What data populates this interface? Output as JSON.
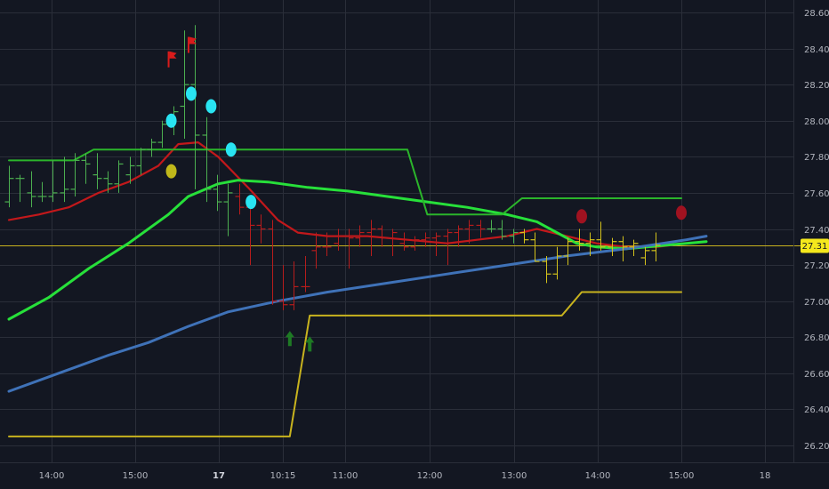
{
  "colors": {
    "background": "#131722",
    "grid": "#2a2e39",
    "bar": "#4caf50",
    "bar_down": "#b71c1c",
    "bar_yellow": "#d4c21b",
    "ma_red": "#c2181b",
    "ma_green": "#27e03a",
    "ma_blue": "#3f72b8",
    "channel_green": "#2bb52b",
    "channel_yellow": "#c8b31e",
    "price_line": "#c8b31e",
    "cyan_marker": "#29e4f2",
    "yellow_marker": "#c0b81a",
    "red_marker": "#a01220",
    "red_flag": "#d81b1b",
    "green_arrow": "#1e7a24",
    "price_tag_bg": "#f5e81c"
  },
  "chart_data": {
    "type": "line",
    "ylim": [
      26.15,
      28.62
    ],
    "y_ticks": [
      "28.60",
      "28.40",
      "28.20",
      "28.00",
      "27.80",
      "27.60",
      "27.40",
      "27.20",
      "27.00",
      "26.80",
      "26.60",
      "26.40",
      "26.20"
    ],
    "x_ticks": [
      {
        "label": "14:00",
        "bold": false
      },
      {
        "label": "15:00",
        "bold": false
      },
      {
        "label": "17",
        "bold": true
      },
      {
        "label": "10:15",
        "bold": false
      },
      {
        "label": "11:00",
        "bold": false
      },
      {
        "label": "12:00",
        "bold": false
      },
      {
        "label": "13:00",
        "bold": false
      },
      {
        "label": "14:00",
        "bold": false
      },
      {
        "label": "15:00",
        "bold": false
      },
      {
        "label": "18",
        "bold": false
      }
    ],
    "current_price": "27.31",
    "current_price_value": 27.31,
    "n_bars": 60,
    "bars": [
      {
        "i": 0,
        "o": 27.55,
        "h": 27.75,
        "l": 27.52,
        "c": 27.68,
        "col": "green"
      },
      {
        "i": 1,
        "o": 27.68,
        "h": 27.7,
        "l": 27.55,
        "c": 27.68,
        "col": "green"
      },
      {
        "i": 2,
        "o": 27.6,
        "h": 27.72,
        "l": 27.52,
        "c": 27.58,
        "col": "green"
      },
      {
        "i": 3,
        "o": 27.58,
        "h": 27.66,
        "l": 27.55,
        "c": 27.58,
        "col": "green"
      },
      {
        "i": 4,
        "o": 27.58,
        "h": 27.78,
        "l": 27.55,
        "c": 27.6,
        "col": "green"
      },
      {
        "i": 5,
        "o": 27.6,
        "h": 27.8,
        "l": 27.55,
        "c": 27.62,
        "col": "green"
      },
      {
        "i": 6,
        "o": 27.62,
        "h": 27.82,
        "l": 27.58,
        "c": 27.78,
        "col": "green"
      },
      {
        "i": 7,
        "o": 27.78,
        "h": 27.82,
        "l": 27.65,
        "c": 27.76,
        "col": "green"
      },
      {
        "i": 8,
        "o": 27.7,
        "h": 27.82,
        "l": 27.62,
        "c": 27.68,
        "col": "green"
      },
      {
        "i": 9,
        "o": 27.68,
        "h": 27.72,
        "l": 27.6,
        "c": 27.65,
        "col": "green"
      },
      {
        "i": 10,
        "o": 27.65,
        "h": 27.78,
        "l": 27.6,
        "c": 27.76,
        "col": "green"
      },
      {
        "i": 11,
        "o": 27.7,
        "h": 27.8,
        "l": 27.65,
        "c": 27.75,
        "col": "green"
      },
      {
        "i": 12,
        "o": 27.75,
        "h": 27.85,
        "l": 27.7,
        "c": 27.84,
        "col": "green"
      },
      {
        "i": 13,
        "o": 27.84,
        "h": 27.9,
        "l": 27.8,
        "c": 27.88,
        "col": "green"
      },
      {
        "i": 14,
        "o": 27.88,
        "h": 28.0,
        "l": 27.85,
        "c": 27.98,
        "col": "green"
      },
      {
        "i": 15,
        "o": 28.0,
        "h": 28.08,
        "l": 27.92,
        "c": 28.05,
        "col": "green"
      },
      {
        "i": 16,
        "o": 28.08,
        "h": 28.5,
        "l": 27.9,
        "c": 28.2,
        "col": "green"
      },
      {
        "i": 17,
        "o": 28.2,
        "h": 28.53,
        "l": 27.62,
        "c": 27.92,
        "col": "green"
      },
      {
        "i": 18,
        "o": 27.92,
        "h": 28.02,
        "l": 27.55,
        "c": 27.62,
        "col": "green"
      },
      {
        "i": 19,
        "o": 27.62,
        "h": 27.7,
        "l": 27.5,
        "c": 27.55,
        "col": "green"
      },
      {
        "i": 20,
        "o": 27.55,
        "h": 27.65,
        "l": 27.36,
        "c": 27.6,
        "col": "green"
      },
      {
        "i": 21,
        "o": 27.58,
        "h": 27.65,
        "l": 27.48,
        "c": 27.52,
        "col": "red"
      },
      {
        "i": 22,
        "o": 27.52,
        "h": 27.55,
        "l": 27.2,
        "c": 27.42,
        "col": "red"
      },
      {
        "i": 23,
        "o": 27.42,
        "h": 27.48,
        "l": 27.32,
        "c": 27.4,
        "col": "red"
      },
      {
        "i": 24,
        "o": 27.4,
        "h": 27.45,
        "l": 26.98,
        "c": 27.0,
        "col": "red"
      },
      {
        "i": 25,
        "o": 27.0,
        "h": 27.2,
        "l": 26.95,
        "c": 26.98,
        "col": "red"
      },
      {
        "i": 26,
        "o": 26.98,
        "h": 27.22,
        "l": 26.95,
        "c": 27.08,
        "col": "red"
      },
      {
        "i": 27,
        "o": 27.08,
        "h": 27.25,
        "l": 27.05,
        "c": 27.08,
        "col": "red"
      },
      {
        "i": 28,
        "o": 27.28,
        "h": 27.38,
        "l": 27.18,
        "c": 27.3,
        "col": "red"
      },
      {
        "i": 29,
        "o": 27.3,
        "h": 27.38,
        "l": 27.25,
        "c": 27.3,
        "col": "red"
      },
      {
        "i": 30,
        "o": 27.32,
        "h": 27.4,
        "l": 27.28,
        "c": 27.36,
        "col": "red"
      },
      {
        "i": 31,
        "o": 27.36,
        "h": 27.4,
        "l": 27.18,
        "c": 27.35,
        "col": "red"
      },
      {
        "i": 32,
        "o": 27.35,
        "h": 27.42,
        "l": 27.3,
        "c": 27.38,
        "col": "red"
      },
      {
        "i": 33,
        "o": 27.38,
        "h": 27.45,
        "l": 27.25,
        "c": 27.4,
        "col": "red"
      },
      {
        "i": 34,
        "o": 27.4,
        "h": 27.42,
        "l": 27.3,
        "c": 27.35,
        "col": "red"
      },
      {
        "i": 35,
        "o": 27.35,
        "h": 27.4,
        "l": 27.25,
        "c": 27.38,
        "col": "red"
      },
      {
        "i": 36,
        "o": 27.32,
        "h": 27.38,
        "l": 27.28,
        "c": 27.3,
        "col": "red"
      },
      {
        "i": 37,
        "o": 27.3,
        "h": 27.36,
        "l": 27.28,
        "c": 27.34,
        "col": "red"
      },
      {
        "i": 38,
        "o": 27.34,
        "h": 27.38,
        "l": 27.3,
        "c": 27.35,
        "col": "red"
      },
      {
        "i": 39,
        "o": 27.35,
        "h": 27.38,
        "l": 27.25,
        "c": 27.36,
        "col": "red"
      },
      {
        "i": 40,
        "o": 27.36,
        "h": 27.4,
        "l": 27.2,
        "c": 27.38,
        "col": "red"
      },
      {
        "i": 41,
        "o": 27.38,
        "h": 27.42,
        "l": 27.3,
        "c": 27.4,
        "col": "red"
      },
      {
        "i": 42,
        "o": 27.4,
        "h": 27.45,
        "l": 27.32,
        "c": 27.42,
        "col": "red"
      },
      {
        "i": 43,
        "o": 27.42,
        "h": 27.45,
        "l": 27.35,
        "c": 27.4,
        "col": "red"
      },
      {
        "i": 44,
        "o": 27.4,
        "h": 27.45,
        "l": 27.38,
        "c": 27.4,
        "col": "green"
      },
      {
        "i": 45,
        "o": 27.4,
        "h": 27.45,
        "l": 27.34,
        "c": 27.36,
        "col": "green"
      },
      {
        "i": 46,
        "o": 27.36,
        "h": 27.4,
        "l": 27.32,
        "c": 27.38,
        "col": "green"
      },
      {
        "i": 47,
        "o": 27.38,
        "h": 27.4,
        "l": 27.32,
        "c": 27.34,
        "col": "yellow"
      },
      {
        "i": 48,
        "o": 27.34,
        "h": 27.38,
        "l": 27.22,
        "c": 27.22,
        "col": "yellow"
      },
      {
        "i": 49,
        "o": 27.22,
        "h": 27.25,
        "l": 27.1,
        "c": 27.15,
        "col": "yellow"
      },
      {
        "i": 50,
        "o": 27.15,
        "h": 27.3,
        "l": 27.12,
        "c": 27.25,
        "col": "yellow"
      },
      {
        "i": 51,
        "o": 27.25,
        "h": 27.35,
        "l": 27.2,
        "c": 27.33,
        "col": "yellow"
      },
      {
        "i": 52,
        "o": 27.33,
        "h": 27.4,
        "l": 27.28,
        "c": 27.32,
        "col": "yellow"
      },
      {
        "i": 53,
        "o": 27.32,
        "h": 27.38,
        "l": 27.25,
        "c": 27.34,
        "col": "yellow"
      },
      {
        "i": 54,
        "o": 27.34,
        "h": 27.44,
        "l": 27.28,
        "c": 27.3,
        "col": "yellow"
      },
      {
        "i": 55,
        "o": 27.3,
        "h": 27.35,
        "l": 27.25,
        "c": 27.33,
        "col": "yellow"
      },
      {
        "i": 56,
        "o": 27.33,
        "h": 27.36,
        "l": 27.22,
        "c": 27.3,
        "col": "yellow"
      },
      {
        "i": 57,
        "o": 27.3,
        "h": 27.34,
        "l": 27.25,
        "c": 27.32,
        "col": "yellow"
      },
      {
        "i": 58,
        "o": 27.24,
        "h": 27.3,
        "l": 27.2,
        "c": 27.28,
        "col": "yellow"
      },
      {
        "i": 59,
        "o": 27.28,
        "h": 27.38,
        "l": 27.22,
        "c": 27.31,
        "col": "yellow"
      }
    ],
    "series": [
      {
        "id": "ma_red",
        "points": [
          [
            0,
            27.45
          ],
          [
            3,
            27.48
          ],
          [
            6,
            27.52
          ],
          [
            9,
            27.6
          ],
          [
            12,
            27.66
          ],
          [
            15,
            27.75
          ],
          [
            17,
            27.87
          ],
          [
            19,
            27.88
          ],
          [
            21,
            27.8
          ],
          [
            24,
            27.63
          ],
          [
            27,
            27.45
          ],
          [
            29,
            27.38
          ],
          [
            32,
            27.36
          ],
          [
            36,
            27.36
          ],
          [
            40,
            27.34
          ],
          [
            44,
            27.32
          ],
          [
            47,
            27.34
          ],
          [
            50,
            27.36
          ],
          [
            53,
            27.4
          ],
          [
            56,
            27.36
          ],
          [
            59,
            27.32
          ],
          [
            62,
            27.3
          ],
          [
            65,
            27.3
          ],
          [
            68,
            27.32
          ],
          [
            70,
            27.33
          ]
        ]
      },
      {
        "id": "ma_green",
        "points": [
          [
            0,
            26.9
          ],
          [
            4,
            27.02
          ],
          [
            8,
            27.18
          ],
          [
            12,
            27.32
          ],
          [
            16,
            27.48
          ],
          [
            18,
            27.58
          ],
          [
            21,
            27.65
          ],
          [
            23,
            27.67
          ],
          [
            26,
            27.66
          ],
          [
            30,
            27.63
          ],
          [
            34,
            27.61
          ],
          [
            38,
            27.58
          ],
          [
            42,
            27.55
          ],
          [
            46,
            27.52
          ],
          [
            50,
            27.48
          ],
          [
            53,
            27.44
          ],
          [
            55,
            27.38
          ],
          [
            57,
            27.32
          ],
          [
            59,
            27.3
          ],
          [
            62,
            27.29
          ],
          [
            66,
            27.31
          ],
          [
            70,
            27.33
          ]
        ]
      },
      {
        "id": "ma_blue",
        "points": [
          [
            0,
            26.5
          ],
          [
            5,
            26.6
          ],
          [
            10,
            26.7
          ],
          [
            14,
            26.77
          ],
          [
            18,
            26.86
          ],
          [
            22,
            26.94
          ],
          [
            27,
            27.0
          ],
          [
            32,
            27.05
          ],
          [
            38,
            27.1
          ],
          [
            44,
            27.15
          ],
          [
            50,
            27.2
          ],
          [
            56,
            27.25
          ],
          [
            62,
            27.29
          ],
          [
            68,
            27.34
          ],
          [
            70,
            27.36
          ]
        ]
      },
      {
        "id": "channel_green",
        "points": [
          [
            0,
            27.78
          ],
          [
            6.5,
            27.78
          ],
          [
            8.5,
            27.84
          ],
          [
            40,
            27.84
          ],
          [
            42,
            27.48
          ],
          [
            49.5,
            27.48
          ],
          [
            51.5,
            27.57
          ],
          [
            67.5,
            27.57
          ]
        ]
      },
      {
        "id": "channel_yellow",
        "points": [
          [
            0,
            26.25
          ],
          [
            28.2,
            26.25
          ],
          [
            30.2,
            26.92
          ],
          [
            55.5,
            26.92
          ],
          [
            57.5,
            27.05
          ],
          [
            67.5,
            27.05
          ]
        ]
      }
    ],
    "markers": {
      "cyan": [
        [
          16.3,
          28.0
        ],
        [
          18.3,
          28.15
        ],
        [
          20.3,
          28.08
        ],
        [
          22.3,
          27.84
        ],
        [
          24.3,
          27.55
        ]
      ],
      "yellow": [
        [
          16.3,
          27.72
        ]
      ],
      "dark_red": [
        [
          57.5,
          27.47
        ],
        [
          67.5,
          27.49
        ]
      ],
      "red_flags": [
        [
          16.3,
          28.34
        ],
        [
          18.3,
          28.42
        ]
      ],
      "green_arrows": [
        [
          28.2,
          26.79
        ],
        [
          30.2,
          26.76
        ]
      ]
    }
  }
}
